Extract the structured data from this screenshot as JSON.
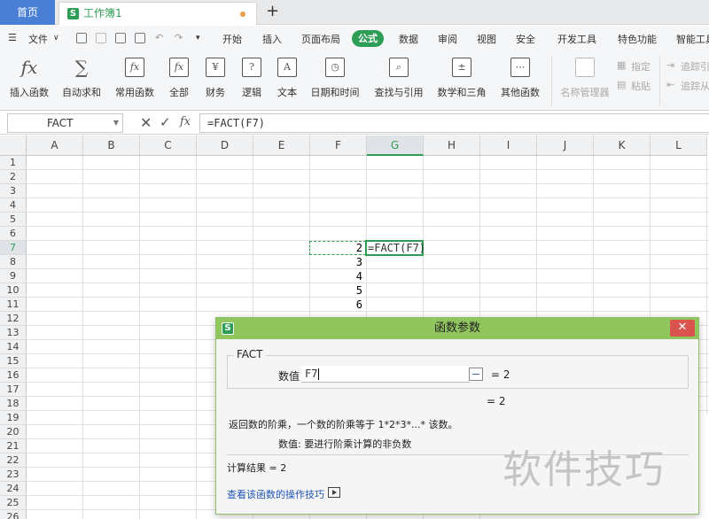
{
  "tabs": {
    "home": "首页",
    "workbook": "工作簿1",
    "new_tab": "+"
  },
  "menubar": {
    "file": "文件",
    "items": [
      "开始",
      "插入",
      "页面布局",
      "公式",
      "数据",
      "审阅",
      "视图",
      "安全",
      "开发工具",
      "特色功能",
      "智能工具"
    ],
    "active": "公式"
  },
  "ribbon": {
    "insert_function": "插入函数",
    "autosum": "自动求和",
    "common_functions": "常用函数",
    "all": "全部",
    "finance": "财务",
    "logic": "逻辑",
    "text": "文本",
    "datetime": "日期和时间",
    "lookup": "查找与引用",
    "math": "数学和三角",
    "other": "其他函数",
    "name_manager": "名称管理器",
    "specify": "指定",
    "paste": "粘贴",
    "trace_precedents": "追踪引",
    "trace_dependents": "追踪从",
    "fx_symbol": "fx",
    "sigma_symbol": "∑"
  },
  "formula_bar": {
    "name_box": "FACT",
    "cancel_symbol": "✕",
    "confirm_symbol": "✓",
    "fx_symbol": "fx",
    "formula": "=FACT(F7)"
  },
  "sheet": {
    "columns": [
      "A",
      "B",
      "C",
      "D",
      "E",
      "F",
      "G",
      "H",
      "I",
      "J",
      "K",
      "L"
    ],
    "selected_column": "G",
    "rows": [
      "1",
      "2",
      "3",
      "4",
      "5",
      "6",
      "7",
      "8",
      "9",
      "10",
      "11",
      "12",
      "13",
      "14",
      "15",
      "16",
      "17",
      "18",
      "19",
      "20",
      "21",
      "22",
      "23",
      "24",
      "25",
      "26"
    ],
    "selected_row": "7",
    "f_values": [
      "2",
      "3",
      "4",
      "5",
      "6"
    ],
    "active_cell": "G7",
    "active_cell_text": "=FACT(F7)"
  },
  "dialog": {
    "title": "函数参数",
    "logo": "S",
    "close_symbol": "✕",
    "function_name": "FACT",
    "arg_label": "数值",
    "arg_value": "F7",
    "arg_result": "= 2",
    "total_result": "= 2",
    "description": "返回数的阶乘，一个数的阶乘等于 1*2*3*...* 该数。",
    "param_description": "数值:  要进行阶乘计算的非负数",
    "calc_result": "计算结果  =  2",
    "help_link": "查看该函数的操作技巧"
  },
  "watermark": "软件技巧",
  "colors": {
    "accent": "#2e9e56",
    "dialog_title": "#91c55e",
    "home_tab": "#4a7fd6",
    "close_button": "#d9534f"
  }
}
